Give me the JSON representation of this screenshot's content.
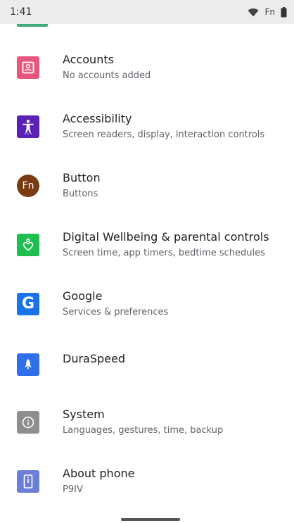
{
  "status_bar": {
    "time": "1:41",
    "fn_label": "Fn",
    "icons": [
      "wifi-icon",
      "battery-icon"
    ]
  },
  "settings": {
    "accounts": {
      "title": "Accounts",
      "subtitle": "No accounts added",
      "icon": "account-box-icon",
      "color": "#e8557d"
    },
    "accessibility": {
      "title": "Accessibility",
      "subtitle": "Screen readers, display, interaction controls",
      "icon": "accessibility-icon",
      "color": "#5b21b6"
    },
    "button": {
      "title": "Button",
      "subtitle": "Buttons",
      "icon_text": "Fn",
      "icon": "fn-icon",
      "color": "#7a3a12"
    },
    "digital_wellbeing": {
      "title": "Digital Wellbeing & parental controls",
      "subtitle": "Screen time, app timers, bedtime schedules",
      "icon": "wellbeing-heart-icon",
      "color": "#1fbf4f"
    },
    "google": {
      "title": "Google",
      "subtitle": "Services & preferences",
      "icon_text": "G",
      "icon": "google-icon",
      "color": "#1a73e8"
    },
    "duraspeed": {
      "title": "DuraSpeed",
      "icon": "rocket-icon",
      "color": "#2f6fea"
    },
    "system": {
      "title": "System",
      "subtitle": "Languages, gestures, time, backup",
      "icon": "info-icon",
      "color": "#8e8e8e"
    },
    "about_phone": {
      "title": "About phone",
      "subtitle": "P9IV",
      "icon": "phone-icon",
      "color": "#6b7fd6"
    }
  }
}
